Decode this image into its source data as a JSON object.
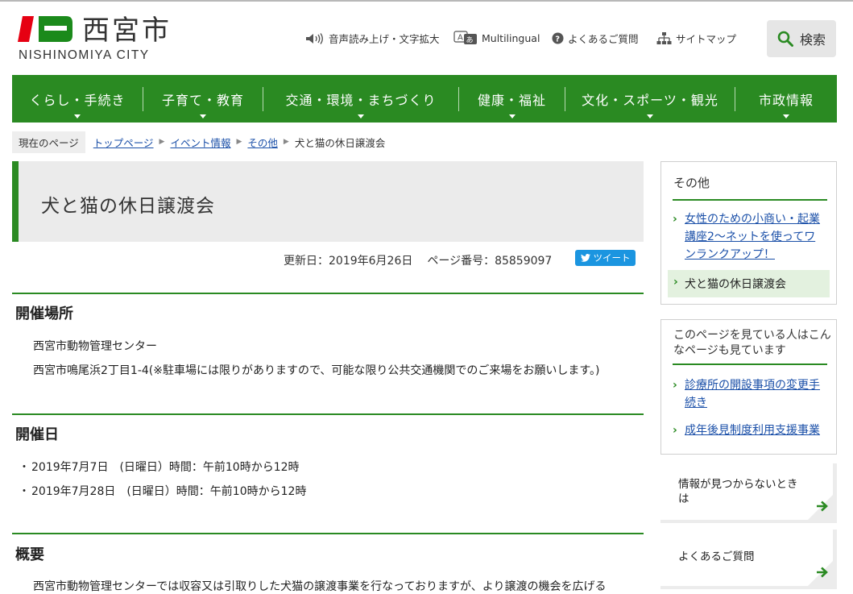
{
  "header": {
    "logo_kanji": "西宮市",
    "logo_roman": "NISHINOMIYA CITY",
    "utility_links": [
      {
        "label": "音声読み上げ・文字拡大",
        "icon": "speaker-icon"
      },
      {
        "label": "Multilingual",
        "icon": "translate-icon"
      },
      {
        "label": "よくあるご質問",
        "icon": "question-circle-icon"
      },
      {
        "label": "サイトマップ",
        "icon": "sitemap-icon"
      }
    ],
    "search_label": "検索"
  },
  "nav": {
    "items": [
      "くらし・手続き",
      "子育て・教育",
      "交通・環境・まちづくり",
      "健康・福祉",
      "文化・スポーツ・観光",
      "市政情報"
    ]
  },
  "breadcrumb": {
    "here_label": "現在のページ",
    "links": [
      "トップページ",
      "イベント情報",
      "その他"
    ],
    "current": "犬と猫の休日譲渡会"
  },
  "page": {
    "title": "犬と猫の休日譲渡会",
    "updated": "更新日：2019年6月26日",
    "page_number": "ページ番号：85859097",
    "tweet_label": "ツイート"
  },
  "sections": {
    "venue": {
      "heading": "開催場所",
      "lines": [
        "西宮市動物管理センター",
        "西宮市鳴尾浜2丁目1-4(※駐車場には限りがありますので、可能な限り公共交通機関でのご来場をお願いします。)"
      ]
    },
    "dates": {
      "heading": "開催日",
      "items": [
        "2019年7月7日　(日曜日）時間：午前10時から12時",
        "2019年7月28日　(日曜日）時間：午前10時から12時"
      ]
    },
    "summary": {
      "heading": "概要",
      "text": "西宮市動物管理センターでは収容又は引取りした犬猫の譲渡事業を行なっておりますが、より譲渡の機会を広げる"
    }
  },
  "sidebar": {
    "category_title": "その他",
    "category_links": [
      "女性のための小商い・起業講座2〜ネットを使ってワンランクアップ！"
    ],
    "category_current": "犬と猫の休日譲渡会",
    "related_title": "このページを見ている人はこんなページも見ています",
    "related_links": [
      "診療所の開設事項の変更手続き",
      "成年後見制度利用支援事業"
    ],
    "card_notfound": "情報が見つからないときは",
    "card_faq": "よくあるご質問"
  },
  "colors": {
    "brand_green": "#2a8a22",
    "link_blue": "#1a4fa8",
    "logo_red": "#e60012",
    "tweet_blue": "#1b95e0"
  }
}
